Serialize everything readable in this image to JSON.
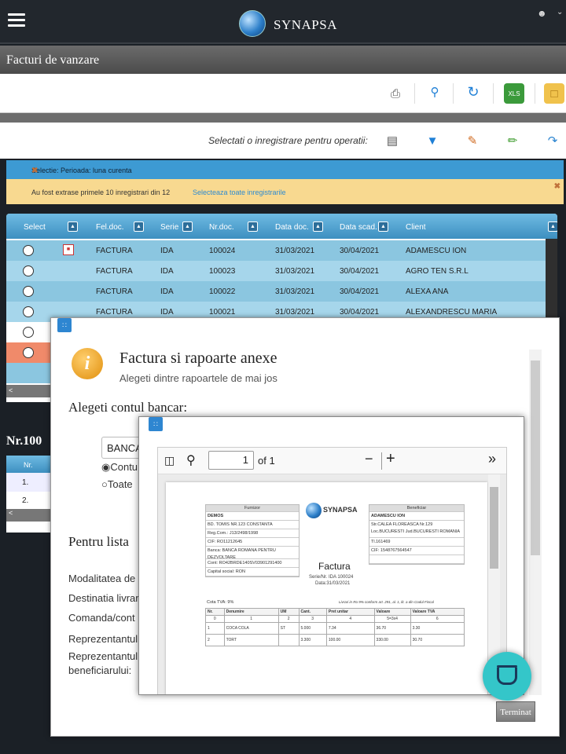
{
  "app": {
    "name": "SYNAPSA"
  },
  "page": {
    "title": "Facturi de vanzare"
  },
  "toolbar2": {
    "prompt": "Selectati o inregistrare pentru operatii:"
  },
  "notifications": {
    "selection": "Selectie: Perioada: luna curenta",
    "extracted": "Au fost extrase primele 10 inregistrari din 12",
    "select_all": "Selecteaza toate inregistrarile"
  },
  "grid": {
    "headers": [
      "Select",
      "Fel.doc.",
      "Serie",
      "Nr.doc.",
      "Data doc.",
      "Data scad.",
      "Client"
    ],
    "rows": [
      {
        "fel": "FACTURA",
        "serie": "IDA",
        "nr": "100024",
        "data": "31/03/2021",
        "scad": "30/04/2021",
        "client": "ADAMESCU ION",
        "pdf": true
      },
      {
        "fel": "FACTURA",
        "serie": "IDA",
        "nr": "100023",
        "data": "31/03/2021",
        "scad": "30/04/2021",
        "client": "AGRO TEN S.R.L"
      },
      {
        "fel": "FACTURA",
        "serie": "IDA",
        "nr": "100022",
        "data": "31/03/2021",
        "scad": "30/04/2021",
        "client": "ALEXA ANA"
      },
      {
        "fel": "FACTURA",
        "serie": "IDA",
        "nr": "100021",
        "data": "31/03/2021",
        "scad": "30/04/2021",
        "client": "ALEXANDRESCU MARIA"
      }
    ]
  },
  "detail": {
    "title": "Nr.100",
    "col": "Nr.",
    "rows": [
      "1.",
      "2."
    ]
  },
  "modal": {
    "title": "Factura si rapoarte anexe",
    "subtitle": "Alegeti dintre rapoartele de mai jos",
    "bank_label": "Alegeti contul bancar:",
    "bank_value": "BANCA",
    "radio1": "Contu",
    "radio2": "Toate",
    "list_label": "Pentru lista",
    "field1": "Modalitatea de",
    "field2": "Destinatia livrar",
    "field3": "Comanda/cont",
    "field4": "Reprezentantul",
    "field5": "Reprezentantul",
    "field5b": "beneficiarului:",
    "close": "Terminat"
  },
  "pdf": {
    "page": "1",
    "of": "of 1",
    "supplier_head": "Furnizor",
    "supplier": [
      "DEMOS",
      "BD. TOMIS NR.123 CONSTANTA",
      "Reg.Com.: J13/2498/1998",
      "CIF: RO11212645",
      "Banca: BANCA ROMANA PENTRU DEZVOLTARE",
      "Cont: RO42BRDE140SV03901291400",
      "Capital social: RON"
    ],
    "client_head": "Beneficiar",
    "client": [
      "ADAMESCU ION",
      "Str.CALEA FLOREASCA Nr.129 Loc.BUCURESTI Jud.BUCURESTI ROMANIA",
      "Tl.161469",
      "CIF: 1548767564547"
    ],
    "logo": "SYNAPSA",
    "doc_title": "Factura",
    "series": "Serie/Nr. IDA 100024",
    "date": "Data:31/03/2021",
    "vat": "Cota TVA: 9%",
    "note": "Livrari in Ro 9% conform art. 291, al. 1, lit. a din Codul Fiscal",
    "cols": [
      "Nr.",
      "Denumire",
      "UM",
      "Cant.",
      "Pret unitar",
      "Valoare",
      "Valoare TVA"
    ],
    "colnums": [
      "0",
      "1",
      "2",
      "3",
      "4",
      "5=3x4",
      "6"
    ],
    "items": [
      [
        "1",
        "COCA COLA",
        "ST",
        "5.000",
        "7.34",
        "36.70",
        "3.30"
      ],
      [
        "2",
        "TORT",
        "",
        "3.300",
        "100.00",
        "330.00",
        "30.70"
      ]
    ]
  }
}
